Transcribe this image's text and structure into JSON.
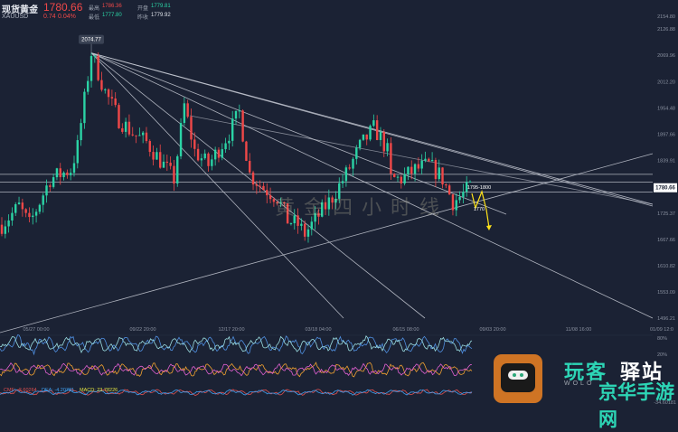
{
  "header": {
    "name": "现货黄金",
    "symbol": "XAUUSD",
    "price": "1780.66",
    "change": "0.74",
    "change_pct": "0.04%",
    "labels": {
      "high": "最高",
      "low": "最低",
      "open": "开盘",
      "prev": "昨收"
    },
    "high": "1786.36",
    "low": "1777.80",
    "open": "1779.81",
    "prev_close": "1779.92"
  },
  "chart_data": {
    "type": "candlestick",
    "instrument": "XAUUSD",
    "y_ticks": [
      "2154.80",
      "2126.88",
      "2069.96",
      "2012.20",
      "1954.48",
      "1897.66",
      "1839.91",
      "1725.37",
      "1667.66",
      "1610.82",
      "1553.09",
      "1496.21"
    ],
    "ylim": [
      1496.21,
      2154.8
    ],
    "x_ticks": [
      "05/27 00:00",
      "09/22 20:00",
      "12/17 20:00",
      "03/18 04:00",
      "06/15 08:00",
      "09/03 20:00",
      "11/08 16:00",
      "01/09 12:0"
    ],
    "series": [
      {
        "type": "candlestick",
        "points": [
          [
            0,
            1700
          ],
          [
            5,
            1740
          ],
          [
            8,
            1700
          ],
          [
            14,
            1800
          ],
          [
            20,
            1820
          ],
          [
            22,
            1870
          ],
          [
            26,
            2074.77
          ],
          [
            30,
            1990
          ],
          [
            34,
            1930
          ],
          [
            38,
            1900
          ],
          [
            42,
            1880
          ],
          [
            46,
            1840
          ],
          [
            50,
            1800
          ],
          [
            53,
            1960
          ],
          [
            56,
            1860
          ],
          [
            60,
            1830
          ],
          [
            66,
            1900
          ],
          [
            69,
            1945
          ],
          [
            72,
            1810
          ],
          [
            76,
            1780
          ],
          [
            80,
            1760
          ],
          [
            83,
            1710
          ],
          [
            86,
            1700
          ],
          [
            88,
            1680
          ],
          [
            92,
            1720
          ],
          [
            96,
            1760
          ],
          [
            100,
            1810
          ],
          [
            104,
            1870
          ],
          [
            108,
            1910
          ],
          [
            110,
            1890
          ],
          [
            112,
            1860
          ],
          [
            113,
            1800
          ],
          [
            116,
            1800
          ],
          [
            120,
            1820
          ],
          [
            124,
            1830
          ],
          [
            127,
            1810
          ],
          [
            128,
            1800
          ],
          [
            131,
            1750
          ],
          [
            133,
            1760
          ],
          [
            136,
            1782
          ]
        ]
      }
    ],
    "current_price": "1780.66",
    "price_label_chart": "2074.77",
    "annotations": [
      "1795-1800",
      "1770"
    ],
    "watermark": "黄金四小时线"
  },
  "indicators": {
    "levels": [
      "80%",
      "20%"
    ],
    "readout": [
      "CMF: -2.60264",
      "DEA: -4.20781",
      "MACD: 23.78226"
    ],
    "right_value": "-34.60181"
  },
  "watermark_logo": {
    "line1": "玩客",
    "line2": "驿站",
    "line3": "WOLO",
    "line4": "京华手游网"
  },
  "colors": {
    "background": "#1b2234",
    "up": "#2bd3a5",
    "down": "#f04848",
    "trendline": "#c8ccd6",
    "annotation": "#ffe21a",
    "price_tag": "#ffffff"
  }
}
